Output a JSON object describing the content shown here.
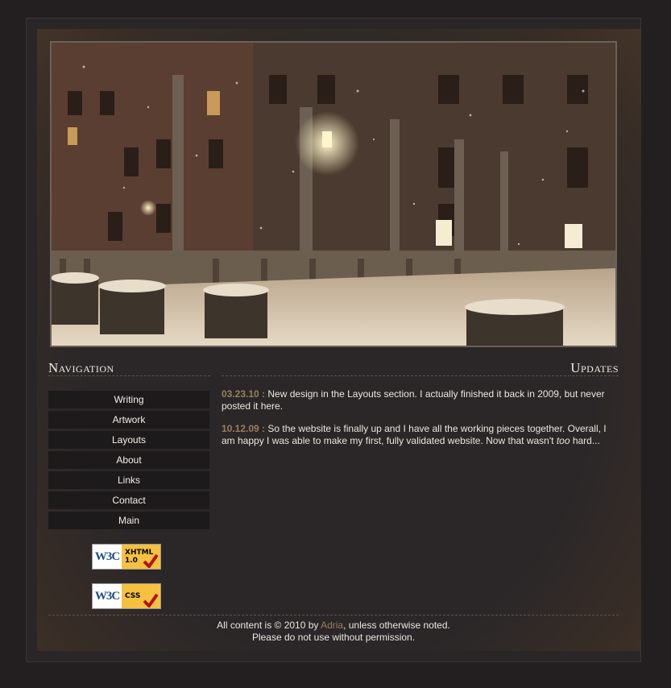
{
  "header": {
    "photo_alt": "snowy night street with lamps"
  },
  "navigation": {
    "title": "Navigation",
    "items": [
      {
        "label": "Writing"
      },
      {
        "label": "Artwork"
      },
      {
        "label": "Layouts"
      },
      {
        "label": "About"
      },
      {
        "label": "Links"
      },
      {
        "label": "Contact"
      },
      {
        "label": "Main"
      }
    ],
    "badges": [
      {
        "left": "W3C",
        "line1": "XHTML",
        "line2": "1.0"
      },
      {
        "left": "W3C",
        "line1": "CSS",
        "line2": ""
      }
    ]
  },
  "updates": {
    "title": "Updates",
    "entries": [
      {
        "date": "03.23.10 :",
        "text": " New design in the Layouts section. I actually finished it back in 2009, but never posted it here."
      },
      {
        "date": "10.12.09 :",
        "text_before": " So the website is finally up and I have all the working pieces together. Overall, I am happy I was able to make my first, fully validated website. Now that wasn't ",
        "emph": "too",
        "text_after": " hard..."
      }
    ]
  },
  "footer": {
    "line1_before": "All content is © 2010 by ",
    "author": "Adria",
    "line1_after": ", unless otherwise noted.",
    "line2": "Please do not use without permission."
  },
  "colors": {
    "background": "#231f20",
    "panel": "#2b2728",
    "nav_button": "#1c1a1b",
    "accent_date": "#9a7e5e"
  }
}
